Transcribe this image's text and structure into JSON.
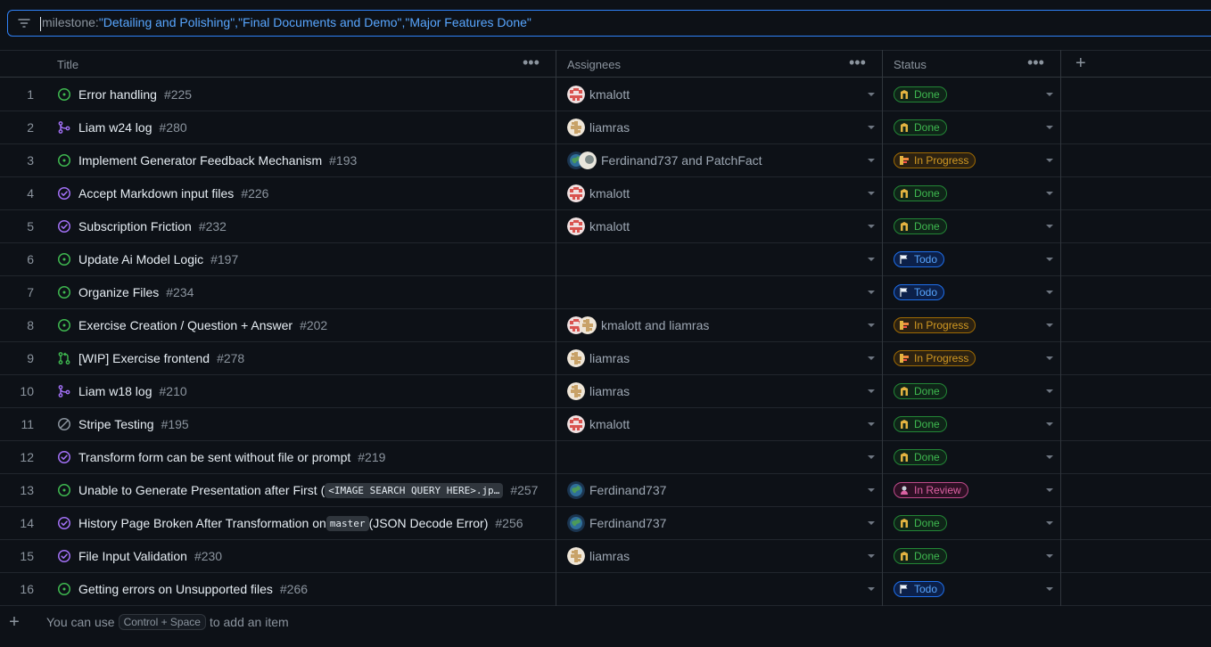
{
  "filter": {
    "key": "milestone:",
    "value": "\"Detailing and Polishing\",\"Final Documents and Demo\",\"Major Features Done\""
  },
  "columns": {
    "title": "Title",
    "assignees": "Assignees",
    "status": "Status"
  },
  "rows": [
    {
      "num": "1",
      "icon": "issue-open-icon",
      "title": "Error handling",
      "number": "#225",
      "assignees": "kmalott",
      "avatars": [
        "kmalott"
      ],
      "status": "Done"
    },
    {
      "num": "2",
      "icon": "pr-merged-icon",
      "title": "Liam w24 log",
      "number": "#280",
      "assignees": "liamras",
      "avatars": [
        "liamras"
      ],
      "status": "Done"
    },
    {
      "num": "3",
      "icon": "issue-open-icon",
      "title": "Implement Generator Feedback Mechanism",
      "number": "#193",
      "assignees": "Ferdinand737 and PatchFact",
      "avatars": [
        "ferdinand",
        "patchfact"
      ],
      "status": "In Progress"
    },
    {
      "num": "4",
      "icon": "issue-closed-icon",
      "title": "Accept Markdown input files",
      "number": "#226",
      "assignees": "kmalott",
      "avatars": [
        "kmalott"
      ],
      "status": "Done"
    },
    {
      "num": "5",
      "icon": "issue-closed-icon",
      "title": "Subscription Friction",
      "number": "#232",
      "assignees": "kmalott",
      "avatars": [
        "kmalott"
      ],
      "status": "Done"
    },
    {
      "num": "6",
      "icon": "issue-open-icon",
      "title": "Update Ai Model Logic",
      "number": "#197",
      "assignees": "",
      "avatars": [],
      "status": "Todo"
    },
    {
      "num": "7",
      "icon": "issue-open-icon",
      "title": "Organize Files",
      "number": "#234",
      "assignees": "",
      "avatars": [],
      "status": "Todo"
    },
    {
      "num": "8",
      "icon": "issue-open-icon",
      "title": "Exercise Creation / Question + Answer",
      "number": "#202",
      "assignees": "kmalott and liamras",
      "avatars": [
        "kmalott",
        "liamras"
      ],
      "status": "In Progress"
    },
    {
      "num": "9",
      "icon": "pr-open-icon",
      "title": "[WIP] Exercise frontend",
      "number": "#278",
      "assignees": "liamras",
      "avatars": [
        "liamras"
      ],
      "status": "In Progress"
    },
    {
      "num": "10",
      "icon": "pr-merged-icon",
      "title": "Liam w18 log",
      "number": "#210",
      "assignees": "liamras",
      "avatars": [
        "liamras"
      ],
      "status": "Done"
    },
    {
      "num": "11",
      "icon": "issue-not-planned-icon",
      "title": "Stripe Testing",
      "number": "#195",
      "assignees": "kmalott",
      "avatars": [
        "kmalott"
      ],
      "status": "Done"
    },
    {
      "num": "12",
      "icon": "issue-closed-icon",
      "title": "Transform form can be sent without file or prompt",
      "number": "#219",
      "assignees": "",
      "avatars": [],
      "status": "Done"
    },
    {
      "num": "13",
      "icon": "issue-open-icon",
      "title": "Unable to Generate Presentation after First (",
      "code": "<IMAGE SEARCH QUERY HERE>.jp…",
      "number": "#257",
      "assignees": "Ferdinand737",
      "avatars": [
        "ferdinand"
      ],
      "status": "In Review"
    },
    {
      "num": "14",
      "icon": "issue-closed-icon",
      "title": "History Page Broken After Transformation on ",
      "code": "master",
      "title_after": " (JSON Decode Error)",
      "number": "#256",
      "assignees": "Ferdinand737",
      "avatars": [
        "ferdinand"
      ],
      "status": "Done"
    },
    {
      "num": "15",
      "icon": "issue-closed-icon",
      "title": "File Input Validation",
      "number": "#230",
      "assignees": "liamras",
      "avatars": [
        "liamras"
      ],
      "status": "Done"
    },
    {
      "num": "16",
      "icon": "issue-open-icon",
      "title": "Getting errors on Unsupported files",
      "number": "#266",
      "assignees": "",
      "avatars": [],
      "status": "Todo"
    }
  ],
  "footer": {
    "prefix": "You can use",
    "shortcut": "Control + Space",
    "suffix": "to add an item"
  },
  "colors": {
    "accent": "#2f81f7",
    "open": "#3fb950",
    "closed": "#a371f7",
    "not_planned": "#8b949e",
    "done": "#3fb950",
    "in_progress": "#d29922",
    "todo": "#58a6ff",
    "in_review": "#db61a2"
  }
}
